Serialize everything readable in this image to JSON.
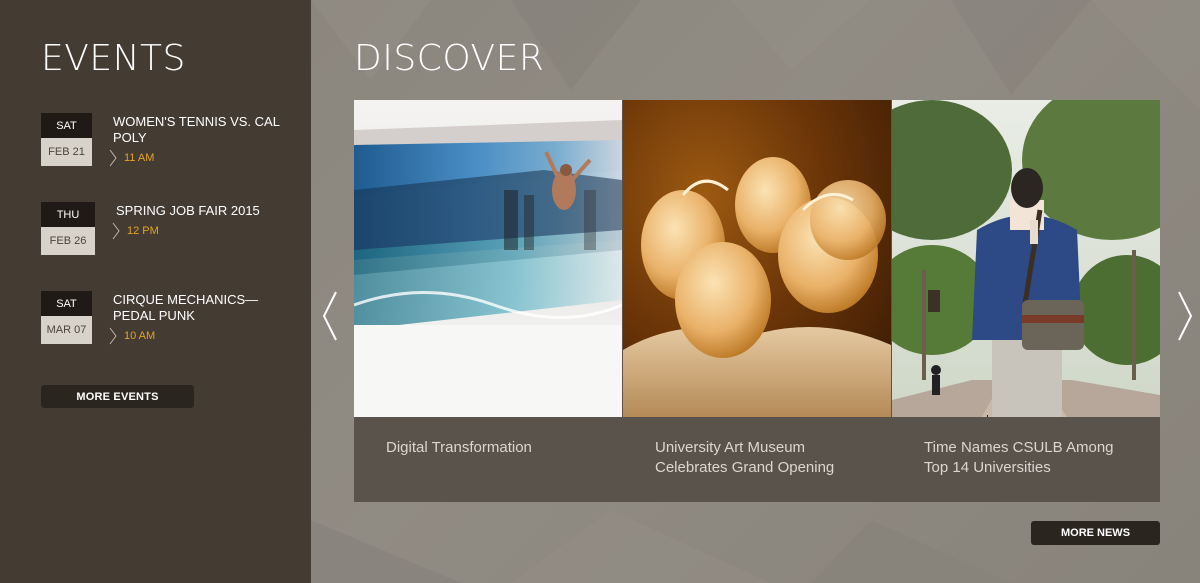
{
  "events": {
    "title": "EVENTS",
    "items": [
      {
        "day": "SAT",
        "date": "FEB 21",
        "title": "WOMEN'S TENNIS VS. CAL POLY",
        "time": "11 AM"
      },
      {
        "day": "THU",
        "date": "FEB 26",
        "title": "SPRING JOB FAIR 2015",
        "time": "12 PM"
      },
      {
        "day": "SAT",
        "date": "MAR 07",
        "title": "CIRQUE MECHANICS—PEDAL PUNK",
        "time": "10 AM"
      }
    ],
    "more_label": "MORE EVENTS"
  },
  "discover": {
    "title": "DISCOVER",
    "cards": [
      {
        "caption": "Digital Transformation",
        "image": "dancer-motion-blur"
      },
      {
        "caption": "University Art Museum Celebrates Grand Opening",
        "image": "glass-sculpture"
      },
      {
        "caption": "Time Names CSULB Among Top 14 Universities",
        "image": "student-on-campus"
      }
    ],
    "more_label": "MORE NEWS"
  },
  "colors": {
    "sidebar_bg": "#443c33",
    "time_accent": "#e2a227",
    "caption_bg": "#5a534c"
  }
}
